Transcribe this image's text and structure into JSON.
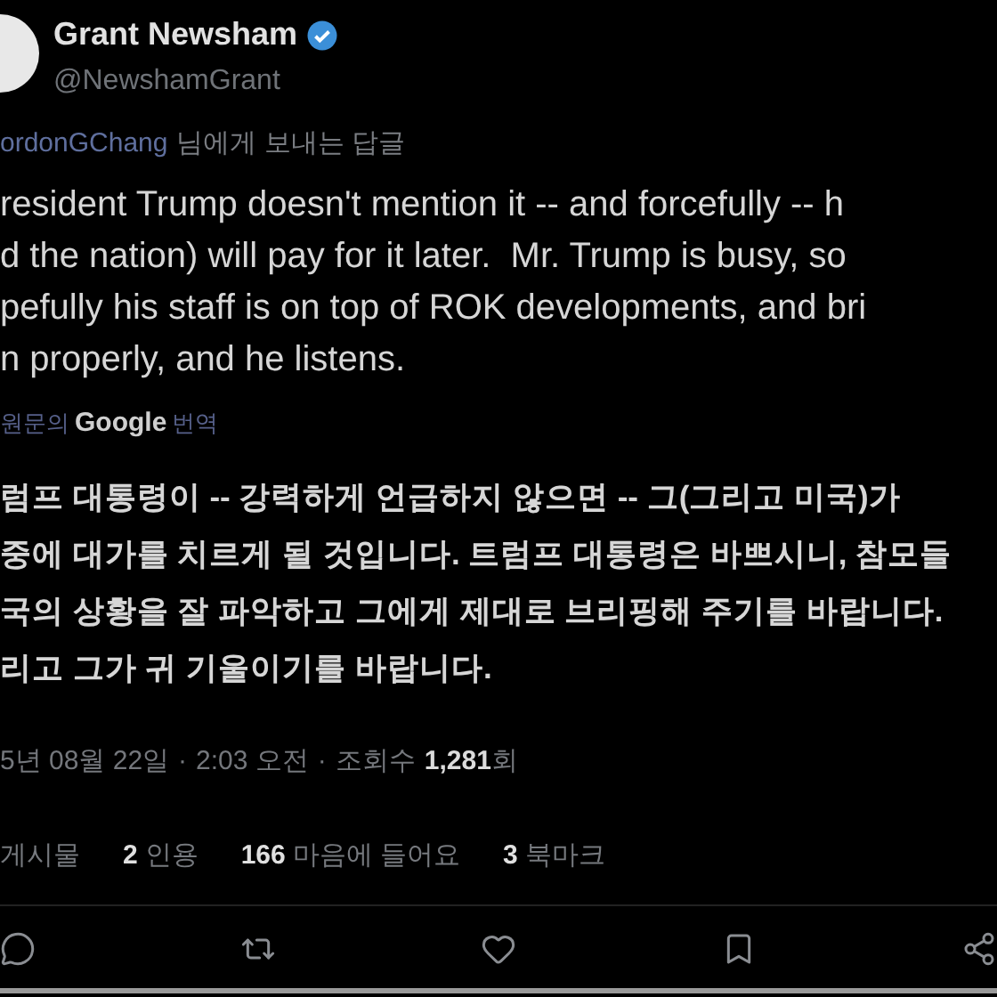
{
  "author": {
    "name": "Grant Newsham",
    "verified": true,
    "handle": "@NewshamGrant"
  },
  "reply_to": {
    "mention": "ordonGChang",
    "label": "님에게 보내는 답글"
  },
  "tweet_lines": [
    "resident Trump doesn't mention it -- and forcefully -- h",
    "d the nation) will pay for it later.  Mr. Trump is busy, so",
    "pefully his staff is on top of ROK developments, and bri",
    "n properly, and he listens."
  ],
  "translation": {
    "prefix": "원문의",
    "brand": "Google",
    "suffix": "번역"
  },
  "translated_lines": [
    "럼프 대통령이 -- 강력하게 언급하지 않으면 -- 그(그리고 미국)가",
    "중에 대가를 치르게 될 것입니다. 트럼프 대통령은 바쁘시니, 참모들",
    "국의 상황을 잘 파악하고 그에게 제대로 브리핑해 주기를 바랍니다.",
    "리고 그가 귀 기울이기를 바랍니다."
  ],
  "meta": {
    "date": "5년 08월 22일",
    "separator": "·",
    "time": "2:03 오전",
    "separator_2": "·",
    "views_label": "조회수",
    "views": "1,281",
    "views_suffix": "회"
  },
  "stats": [
    {
      "label": "게시물"
    },
    {
      "count": "2",
      "label": "인용"
    },
    {
      "count": "166",
      "label": "마음에 들어요"
    },
    {
      "count": "3",
      "label": "북마크"
    }
  ],
  "actions": [
    {
      "kind": "reply"
    },
    {
      "kind": "repost"
    },
    {
      "kind": "like"
    },
    {
      "kind": "bookmark"
    },
    {
      "kind": "share"
    }
  ]
}
